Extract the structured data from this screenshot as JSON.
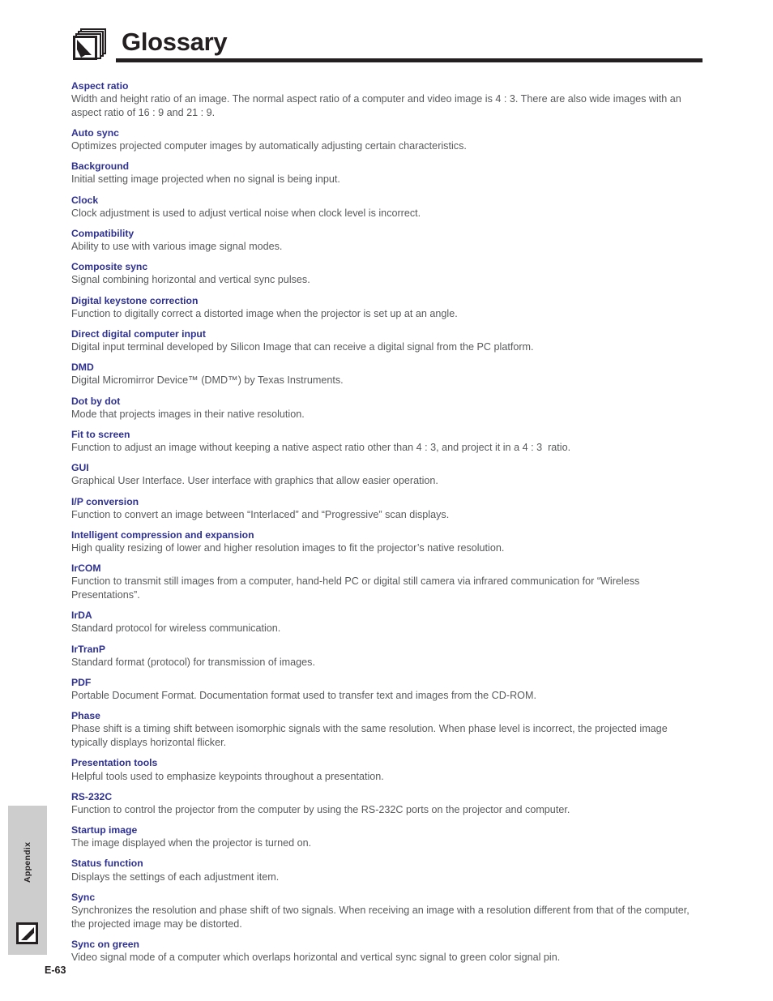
{
  "header": {
    "title": "Glossary",
    "icon": "book-stack-cursor-icon"
  },
  "glossary": {
    "entries": [
      {
        "term": "Aspect ratio",
        "definition": "Width and height ratio of an image. The normal aspect ratio of a computer and video image is 4 : 3. There are also wide images with an aspect ratio of 16 : 9 and 21 : 9."
      },
      {
        "term": "Auto sync",
        "definition": "Optimizes projected computer images by automatically adjusting certain characteristics."
      },
      {
        "term": "Background",
        "definition": "Initial setting image projected when no signal is being input."
      },
      {
        "term": "Clock",
        "definition": "Clock adjustment is used to adjust vertical noise when clock level is incorrect."
      },
      {
        "term": "Compatibility",
        "definition": "Ability to use with various image signal modes."
      },
      {
        "term": "Composite sync",
        "definition": "Signal combining horizontal and vertical sync pulses."
      },
      {
        "term": "Digital keystone correction",
        "definition": "Function to digitally correct a distorted image when the projector is set up at an angle."
      },
      {
        "term": "Direct digital computer input",
        "definition": "Digital input terminal developed by Silicon Image that can receive a digital signal from the PC platform."
      },
      {
        "term": "DMD",
        "definition": "Digital Micromirror Device™ (DMD™) by Texas Instruments."
      },
      {
        "term": "Dot by dot",
        "definition": "Mode that projects images in their native resolution."
      },
      {
        "term": "Fit to screen",
        "definition": "Function to adjust an image without keeping a native aspect ratio other than 4 : 3, and project it in a 4 : 3  ratio."
      },
      {
        "term": "GUI",
        "definition": "Graphical User Interface. User interface with graphics that allow easier operation."
      },
      {
        "term": "I/P conversion",
        "definition": "Function to convert an image between “Interlaced” and “Progressive” scan displays."
      },
      {
        "term": "Intelligent compression and expansion",
        "definition": "High quality resizing of lower and higher resolution images to fit the projector’s native resolution."
      },
      {
        "term": "IrCOM",
        "definition": "Function to transmit still images from a computer, hand-held PC or digital still camera via infrared communication for “Wireless Presentations”."
      },
      {
        "term": "IrDA",
        "definition": "Standard protocol for wireless communication."
      },
      {
        "term": "IrTranP",
        "definition": "Standard format (protocol) for transmission of images."
      },
      {
        "term": "PDF",
        "definition": "Portable Document Format. Documentation format used to transfer text and images from the CD-ROM."
      },
      {
        "term": "Phase",
        "definition": "Phase shift is a timing shift between isomorphic signals with the same resolution. When phase level is incorrect, the projected image typically displays horizontal flicker."
      },
      {
        "term": "Presentation tools",
        "definition": "Helpful tools used to emphasize keypoints throughout a presentation."
      },
      {
        "term": "RS-232C",
        "definition": "Function to control the projector from the computer by using the RS-232C ports on the projector and computer."
      },
      {
        "term": "Startup image",
        "definition": "The image displayed when the projector is turned on."
      },
      {
        "term": "Status function",
        "definition": "Displays the settings of each adjustment item."
      },
      {
        "term": "Sync",
        "definition": "Synchronizes the resolution and phase shift of two signals. When receiving an image with a resolution different from that of the computer, the projected image may be distorted."
      },
      {
        "term": "Sync on green",
        "definition": "Video signal mode of a computer which overlaps horizontal and vertical sync signal to green color signal pin."
      }
    ]
  },
  "side_tab": {
    "label": "Appendix",
    "icon": "pen-square-icon"
  },
  "footer": {
    "page_number": "E-63"
  },
  "colors": {
    "term": "#2e3192",
    "body_text": "#58595b",
    "rule": "#231f20",
    "side_tab_bg": "#cdcdcd"
  }
}
